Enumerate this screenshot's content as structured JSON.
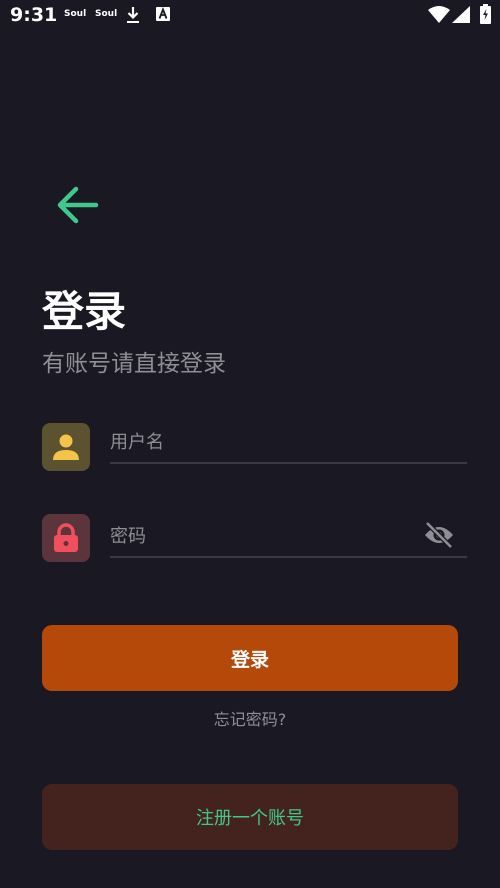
{
  "status_bar": {
    "time": "9:31",
    "notifications": [
      "Soul",
      "Soul"
    ],
    "icons": [
      "download-icon",
      "a-app-icon",
      "wifi-icon",
      "signal-icon",
      "battery-charging-icon"
    ]
  },
  "header": {
    "back_icon": "arrow-left-icon",
    "title": "登录",
    "subtitle": "有账号请直接登录"
  },
  "form": {
    "username": {
      "icon": "person-icon",
      "placeholder": "用户名",
      "value": ""
    },
    "password": {
      "icon": "lock-icon",
      "placeholder": "密码",
      "value": "",
      "toggle_icon": "eye-off-icon"
    }
  },
  "actions": {
    "login_label": "登录",
    "forgot_label": "忘记密码?",
    "register_label": "注册一个账号"
  },
  "colors": {
    "background": "#1a1822",
    "accent_green": "#3fc78e",
    "login_button": "#b4490a",
    "register_button": "#44231e",
    "user_icon": "#f3c34a",
    "lock_icon": "#f0505d"
  }
}
